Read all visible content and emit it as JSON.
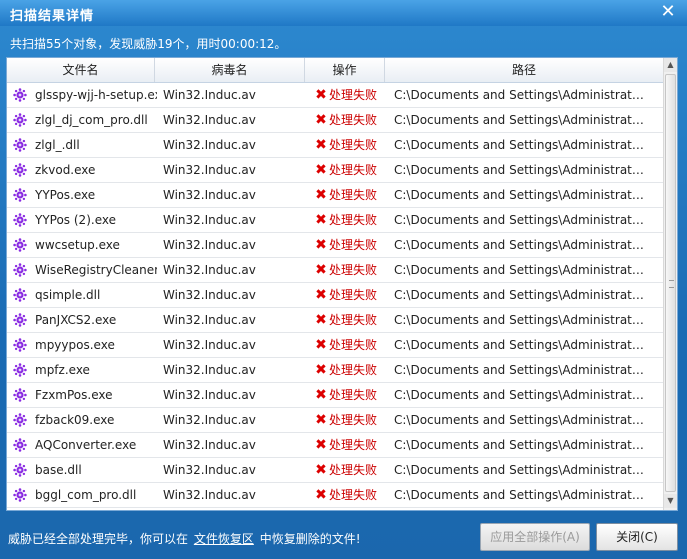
{
  "window": {
    "title": "扫描结果详情",
    "close_glyph": "✕"
  },
  "summary": "共扫描55个对象，发现威胁19个，用时00:00:12。",
  "table": {
    "headers": [
      "文件名",
      "病毒名",
      "操作",
      "路径"
    ],
    "rows": [
      {
        "file": "glsspy-wjj-h-setup.exe",
        "virus": "Win32.Induc.av",
        "action": "处理失败",
        "path": "C:\\Documents and Settings\\Administrator\\桌..."
      },
      {
        "file": "zlgl_dj_com_pro.dll",
        "virus": "Win32.Induc.av",
        "action": "处理失败",
        "path": "C:\\Documents and Settings\\Administrator\\桌..."
      },
      {
        "file": "zlgl_.dll",
        "virus": "Win32.Induc.av",
        "action": "处理失败",
        "path": "C:\\Documents and Settings\\Administrator\\桌..."
      },
      {
        "file": "zkvod.exe",
        "virus": "Win32.Induc.av",
        "action": "处理失败",
        "path": "C:\\Documents and Settings\\Administrator\\桌..."
      },
      {
        "file": "YYPos.exe",
        "virus": "Win32.Induc.av",
        "action": "处理失败",
        "path": "C:\\Documents and Settings\\Administrator\\桌..."
      },
      {
        "file": "YYPos (2).exe",
        "virus": "Win32.Induc.av",
        "action": "处理失败",
        "path": "C:\\Documents and Settings\\Administrator\\桌..."
      },
      {
        "file": "wwcsetup.exe",
        "virus": "Win32.Induc.av",
        "action": "处理失败",
        "path": "C:\\Documents and Settings\\Administrator\\桌..."
      },
      {
        "file": "WiseRegistryCleaner.",
        "virus": "Win32.Induc.av",
        "action": "处理失败",
        "path": "C:\\Documents and Settings\\Administrator\\桌..."
      },
      {
        "file": "qsimple.dll",
        "virus": "Win32.Induc.av",
        "action": "处理失败",
        "path": "C:\\Documents and Settings\\Administrator\\桌..."
      },
      {
        "file": "PanJXCS2.exe",
        "virus": "Win32.Induc.av",
        "action": "处理失败",
        "path": "C:\\Documents and Settings\\Administrator\\桌..."
      },
      {
        "file": "mpyypos.exe",
        "virus": "Win32.Induc.av",
        "action": "处理失败",
        "path": "C:\\Documents and Settings\\Administrator\\桌..."
      },
      {
        "file": "mpfz.exe",
        "virus": "Win32.Induc.av",
        "action": "处理失败",
        "path": "C:\\Documents and Settings\\Administrator\\桌..."
      },
      {
        "file": "FzxmPos.exe",
        "virus": "Win32.Induc.av",
        "action": "处理失败",
        "path": "C:\\Documents and Settings\\Administrator\\桌..."
      },
      {
        "file": "fzback09.exe",
        "virus": "Win32.Induc.av",
        "action": "处理失败",
        "path": "C:\\Documents and Settings\\Administrator\\桌..."
      },
      {
        "file": "AQConverter.exe",
        "virus": "Win32.Induc.av",
        "action": "处理失败",
        "path": "C:\\Documents and Settings\\Administrator\\桌..."
      },
      {
        "file": "base.dll",
        "virus": "Win32.Induc.av",
        "action": "处理失败",
        "path": "C:\\Documents and Settings\\Administrator\\桌..."
      },
      {
        "file": "bggl_com_pro.dll",
        "virus": "Win32.Induc.av",
        "action": "处理失败",
        "path": "C:\\Documents and Settings\\Administrator\\桌..."
      }
    ]
  },
  "footer": {
    "text_before": "威胁已经全部处理完毕，你可以在",
    "link": "文件恢复区",
    "text_after": "中恢复删除的文件!",
    "apply_all_label": "应用全部操作(A)",
    "close_label": "关闭(C)"
  },
  "colors": {
    "fail_red": "#cc0000",
    "virus_icon": "#8a2be2",
    "window_blue": "#1a6bb4"
  },
  "icons": {
    "virus": "virus-icon",
    "fail": "fail-x-icon",
    "close": "close-icon"
  }
}
